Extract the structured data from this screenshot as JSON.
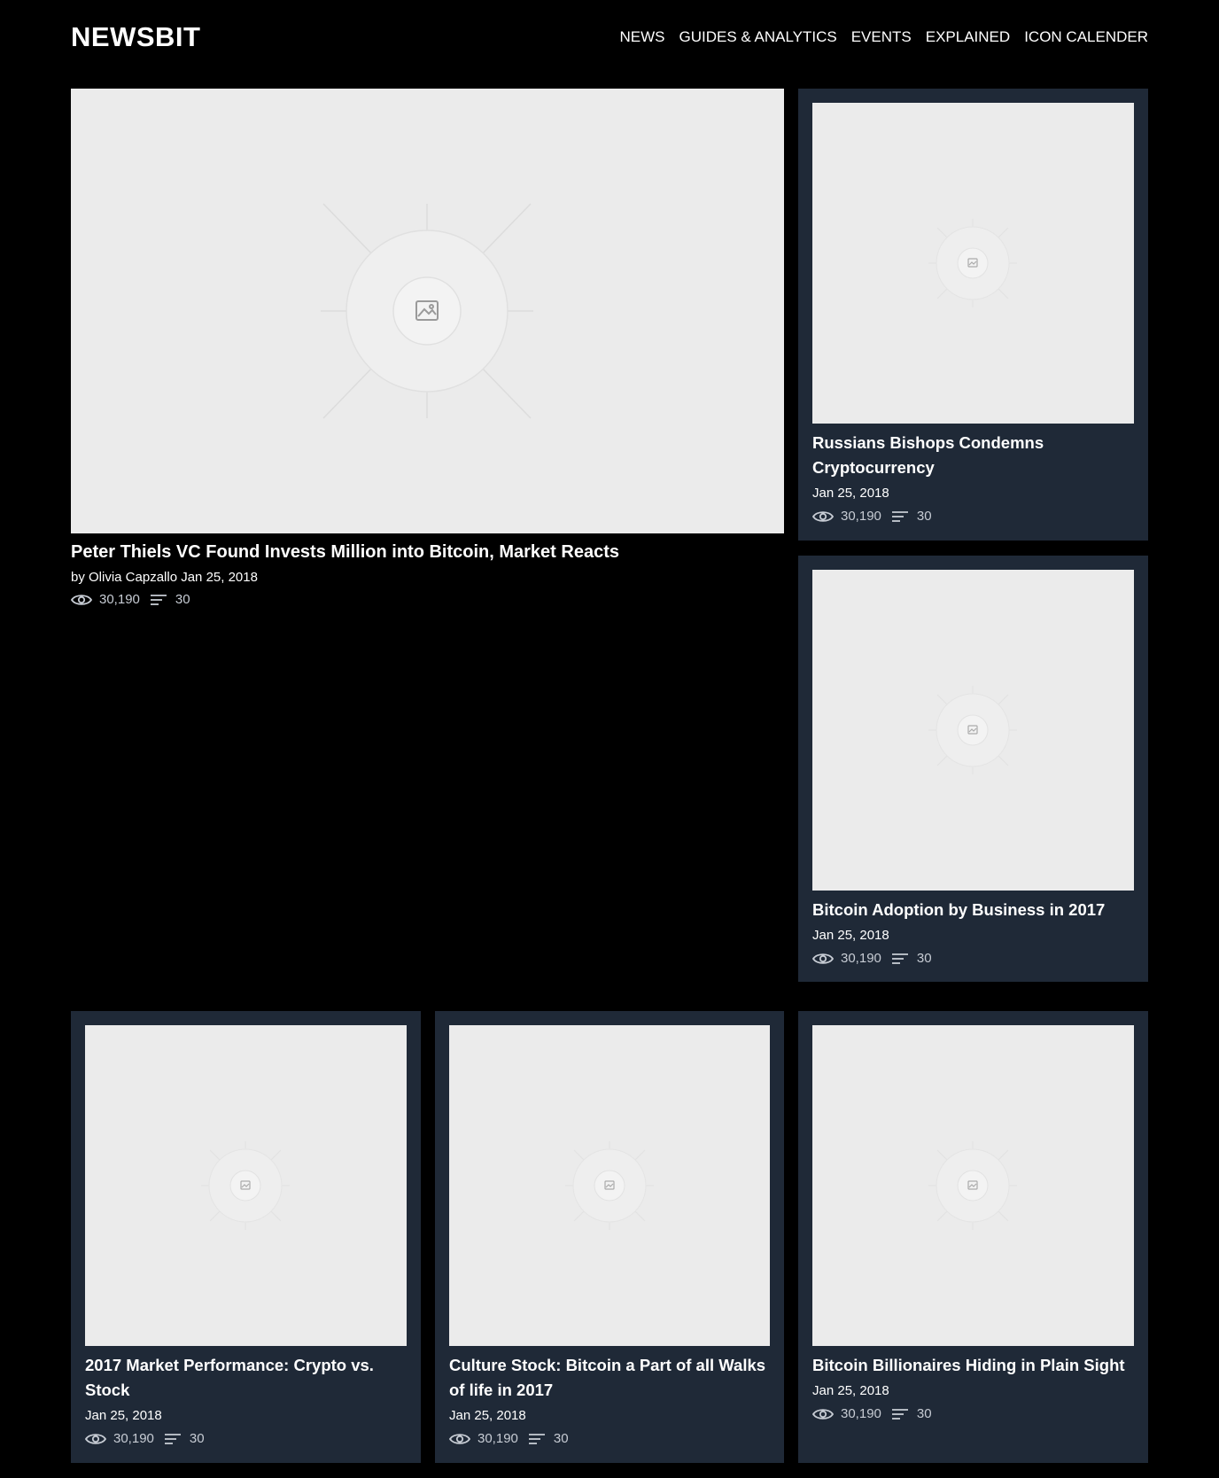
{
  "brand": {
    "logo": "NEWSBIT"
  },
  "nav": [
    {
      "label": "NEWS"
    },
    {
      "label": "GUIDES & ANALYTICS"
    },
    {
      "label": "EVENTS"
    },
    {
      "label": "EXPLAINED"
    },
    {
      "label": "ICON CALENDER"
    }
  ],
  "icons": {
    "image": "image-placeholder-icon",
    "views": "eye-icon",
    "comments": "lines-icon"
  },
  "colors": {
    "background": "#000000",
    "card": "#1f2937",
    "placeholder": "#ebebeb",
    "stat_text": "#c7ccd4"
  },
  "hero": {
    "title": "Peter Thiels VC Found Invests Million into Bitcoin, Market Reacts",
    "byline": "by Olivia Capzallo Jan 25, 2018",
    "views": "30,190",
    "comments": "30"
  },
  "side_cards": [
    {
      "title": "Russians Bishops Condemns Cryptocurrency",
      "date": "Jan 25, 2018",
      "views": "30,190",
      "comments": "30"
    },
    {
      "title": "Bitcoin Adoption by Business in 2017",
      "date": "Jan 25, 2018",
      "views": "30,190",
      "comments": "30"
    }
  ],
  "bottom_cards": [
    {
      "title": "2017 Market Performance: Crypto vs. Stock",
      "date": "Jan 25, 2018",
      "views": "30,190",
      "comments": "30"
    },
    {
      "title": "Culture Stock: Bitcoin a Part of all Walks of life in 2017",
      "date": "Jan 25, 2018",
      "views": "30,190",
      "comments": "30"
    },
    {
      "title": "Bitcoin Billionaires Hiding in Plain Sight",
      "date": "Jan 25, 2018",
      "views": "30,190",
      "comments": "30"
    }
  ]
}
